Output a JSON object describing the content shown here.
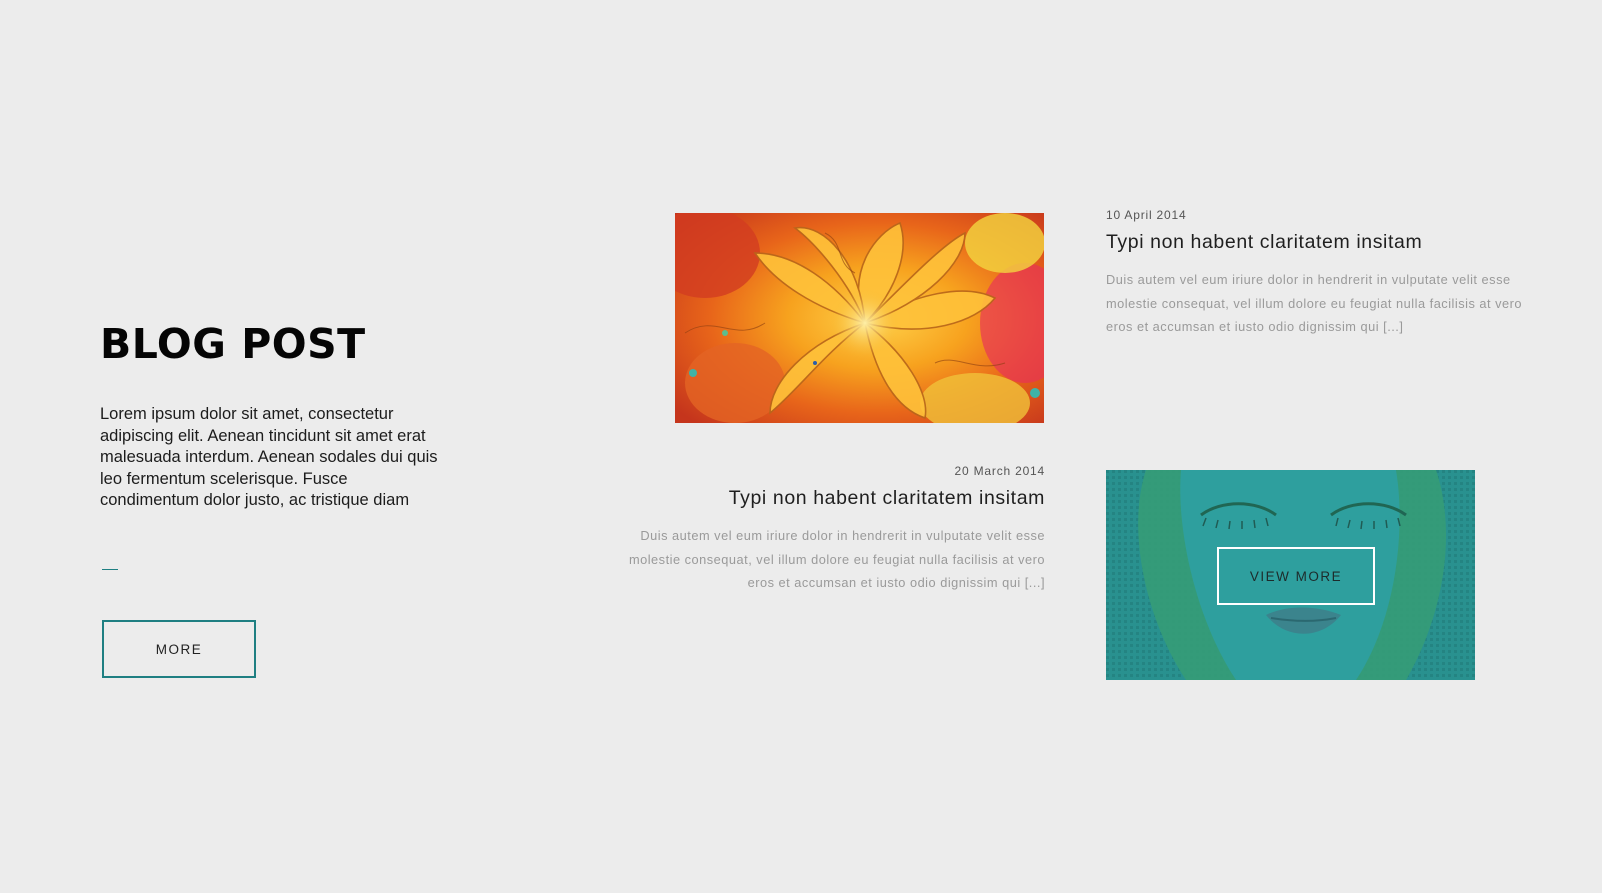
{
  "intro": {
    "title": "BLOG POST",
    "text": "Lorem ipsum dolor sit amet, consectetur adipiscing elit. Aenean tincidunt sit amet erat malesuada interdum. Aenean sodales dui quis leo fermentum scelerisque. Fusce condimentum dolor justo, ac tristique diam",
    "more_label": "MORE"
  },
  "posts": [
    {
      "date": "10 April 2014",
      "title": "Typi non habent claritatem insitam",
      "excerpt": "Duis autem vel eum iriure dolor in hendrerit in vulputate velit esse molestie consequat, vel illum dolore eu feugiat nulla facilisis at vero eros et accumsan et iusto odio dignissim qui [...]"
    },
    {
      "date": "20 March 2014",
      "title": "Typi non habent claritatem insitam",
      "excerpt": "Duis autem vel eum iriure dolor in hendrerit in vulputate velit esse molestie consequat, vel illum dolore eu feugiat nulla facilisis at vero eros et accumsan et iusto odio dignissim qui [...]"
    }
  ],
  "overlay": {
    "view_more_label": "VIEW MORE"
  },
  "colors": {
    "background": "#ececec",
    "accent": "#1f7f82",
    "teal_overlay": "#2a9b9b"
  },
  "images": [
    {
      "subject": "orange-flower-painting"
    },
    {
      "subject": "teal-pop-art-face"
    }
  ]
}
